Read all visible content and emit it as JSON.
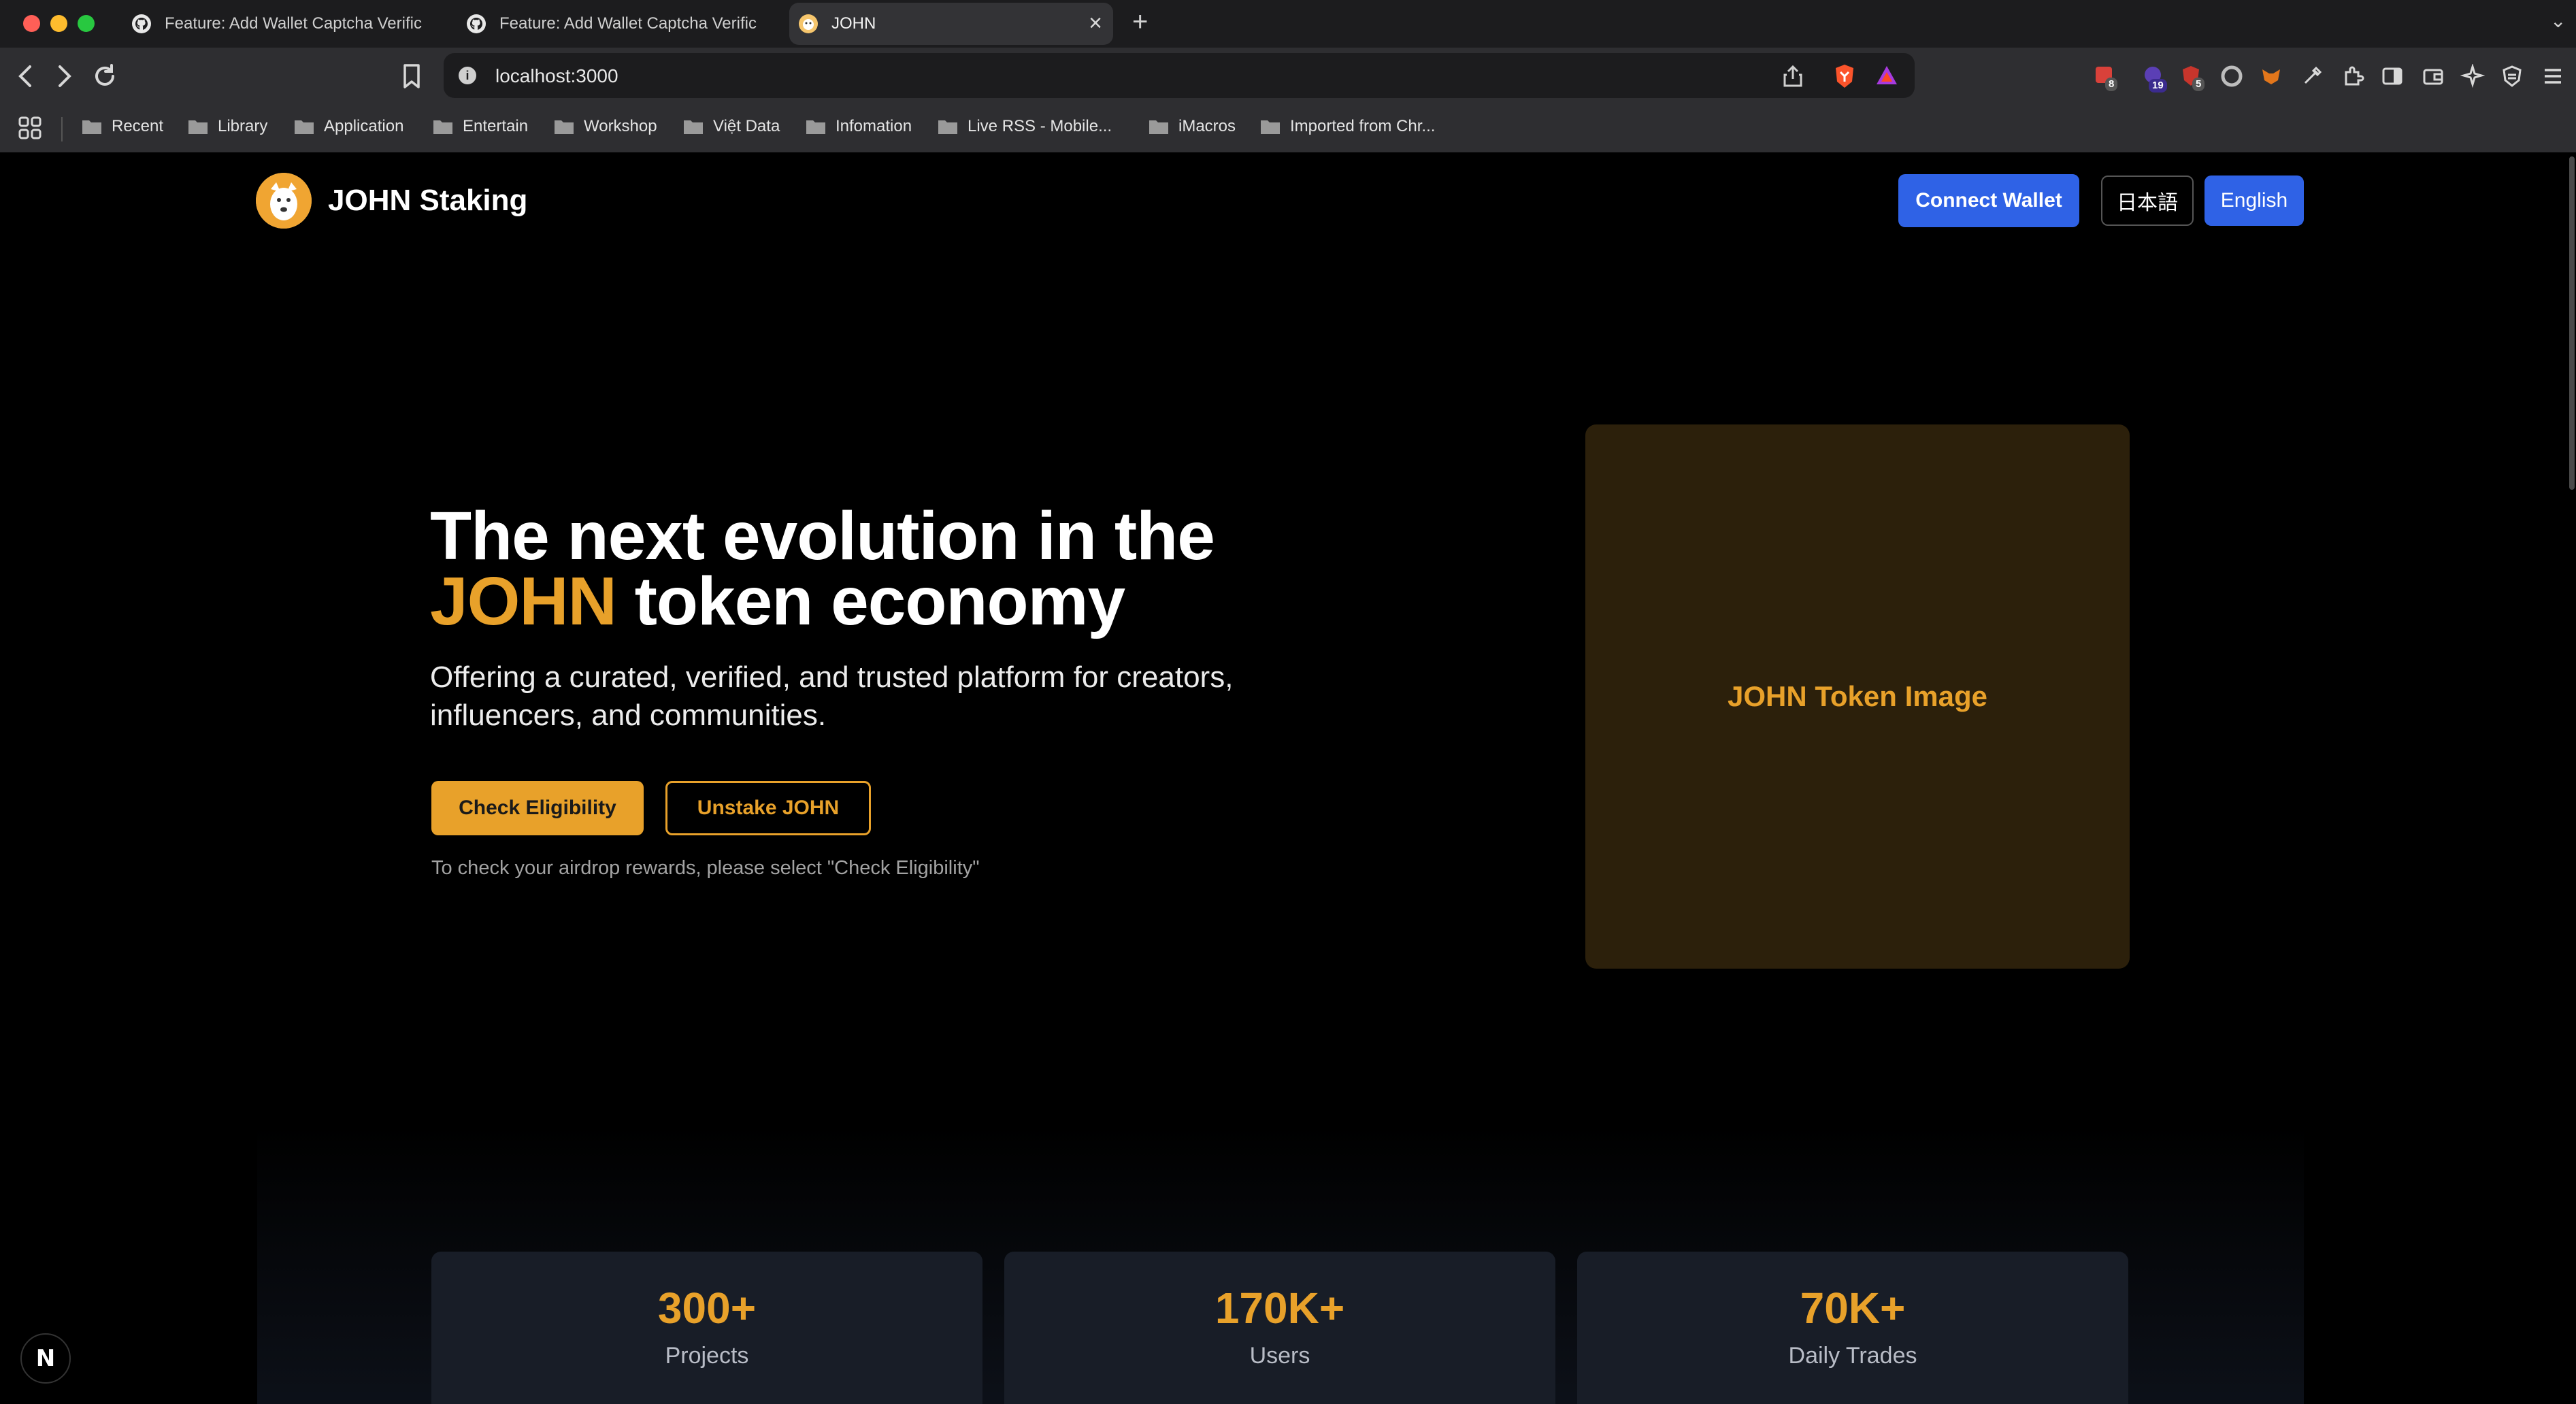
{
  "browser": {
    "tabs": [
      {
        "label": "Feature: Add Wallet Captcha Verific",
        "icon": "github-icon"
      },
      {
        "label": "Feature: Add Wallet Captcha Verific",
        "icon": "github-icon"
      },
      {
        "label": "JOHN",
        "icon": "john-favicon"
      }
    ],
    "url": "localhost:3000",
    "extension_badges": [
      "8",
      "19",
      "5"
    ],
    "bookmarks": [
      "Recent",
      "Library",
      "Application",
      "Entertain",
      "Workshop",
      "Việt Data",
      "Infomation",
      "Live RSS - Mobile...",
      "iMacros",
      "Imported from Chr..."
    ]
  },
  "header": {
    "brand": "JOHN Staking",
    "connect_wallet": "Connect Wallet",
    "lang_ja": "日本語",
    "lang_en": "English"
  },
  "hero": {
    "title_line1": "The next evolution in the",
    "title_highlight": "JOHN",
    "title_rest": " token economy",
    "subtitle": "Offering a curated, verified, and trusted platform for creators, influencers, and communities.",
    "check_button": "Check Eligibility",
    "unstake_button": "Unstake JOHN",
    "hint": "To check your airdrop rewards, please select \"Check Eligibility\"",
    "image_label": "JOHN Token Image"
  },
  "stats": [
    {
      "value": "300+",
      "label": "Projects"
    },
    {
      "value": "170K+",
      "label": "Users"
    },
    {
      "value": "70K+",
      "label": "Daily Trades"
    }
  ],
  "dev_badge": "N",
  "colors": {
    "accent": "#e8a12a",
    "primary": "#2f62e6",
    "background": "#000000",
    "card": "#181d27"
  }
}
